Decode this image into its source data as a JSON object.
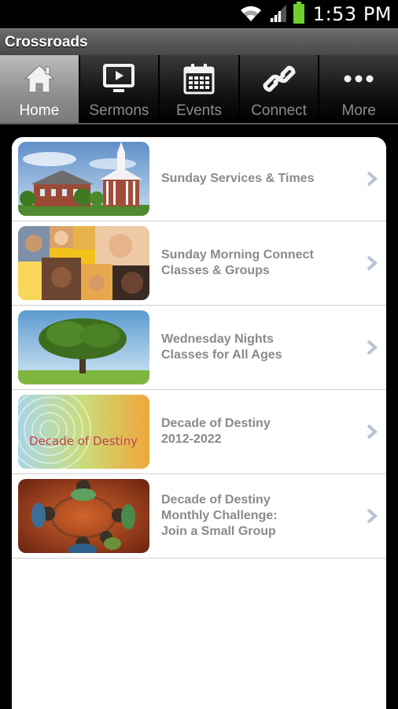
{
  "status_bar": {
    "time": "1:53 PM",
    "icons": [
      "wifi-icon",
      "signal-icon",
      "battery-icon"
    ]
  },
  "app_bar": {
    "title": "Crossroads"
  },
  "tabs": [
    {
      "label": "Home",
      "icon": "home-icon",
      "active": true
    },
    {
      "label": "Sermons",
      "icon": "tv-icon",
      "active": false
    },
    {
      "label": "Events",
      "icon": "calendar-icon",
      "active": false
    },
    {
      "label": "Connect",
      "icon": "link-icon",
      "active": false
    },
    {
      "label": "More",
      "icon": "more-dots-icon",
      "active": false
    }
  ],
  "list": [
    {
      "line1": "Sunday Services & Times",
      "line2": "",
      "line3": "",
      "image": "church-building"
    },
    {
      "line1": "Sunday Morning Connect",
      "line2": "Classes & Groups",
      "line3": "",
      "image": "people-collage"
    },
    {
      "line1": "Wednesday Nights",
      "line2": "Classes for All Ages",
      "line3": "",
      "image": "tree-field"
    },
    {
      "line1": "Decade of Destiny",
      "line2": "2012-2022",
      "line3": "",
      "image": "decade-of-destiny-logo",
      "image_text": "Decade of Destiny"
    },
    {
      "line1": "Decade of Destiny",
      "line2": "Monthly Challenge:",
      "line3": "Join a Small Group",
      "image": "small-group-circle"
    }
  ],
  "colors": {
    "tab_active": "#9a9a9a",
    "item_text": "#8a8a8a",
    "chevron": "#b8c4d4"
  }
}
